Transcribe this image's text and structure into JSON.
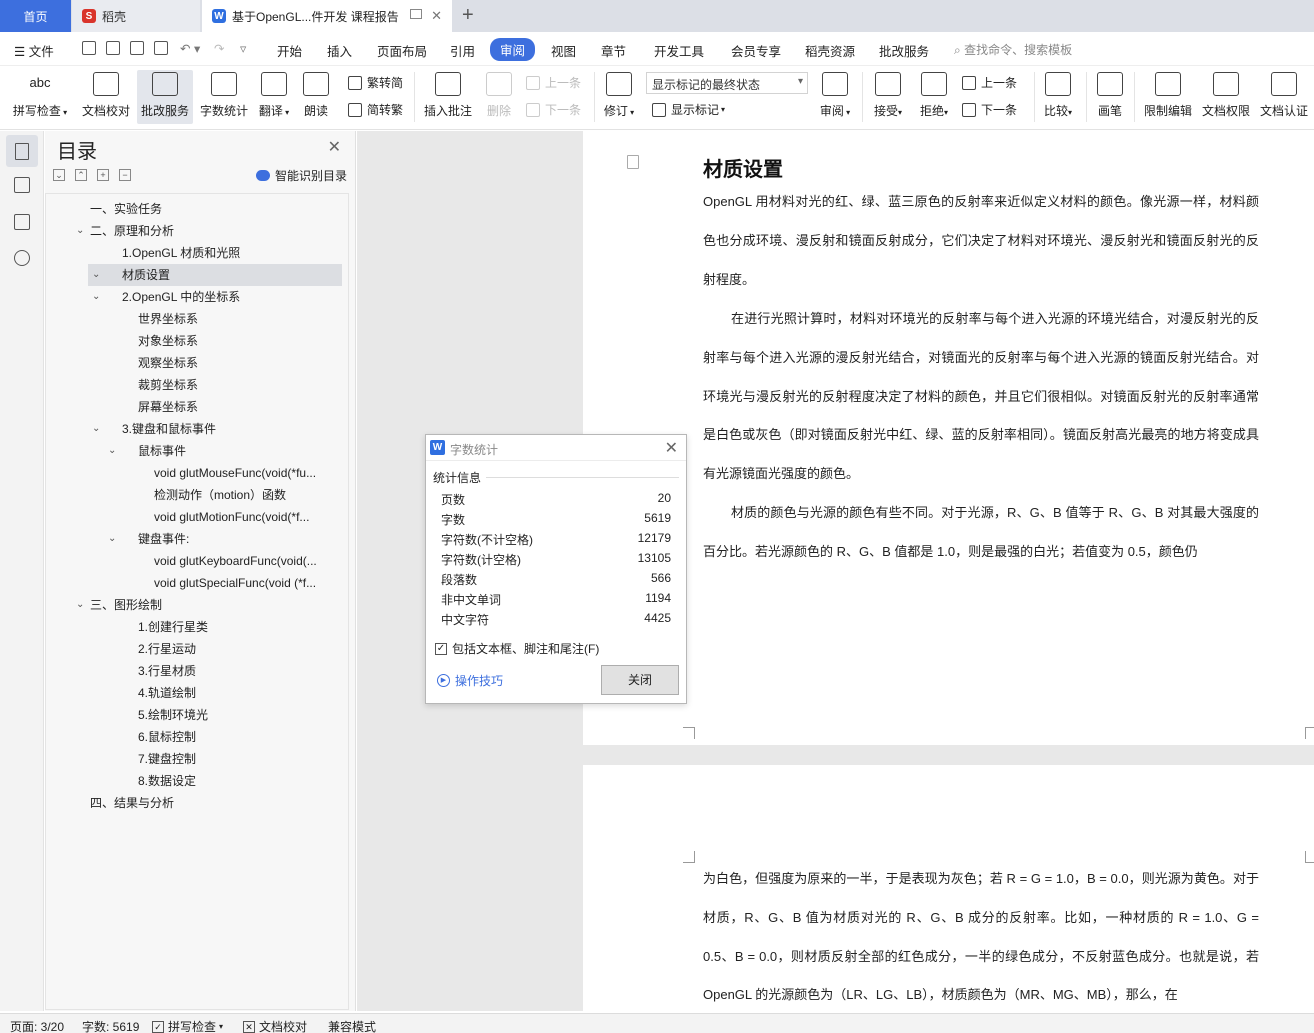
{
  "tabs": {
    "home": "首页",
    "daoke": "稻壳",
    "doc": "基于OpenGL...件开发 课程报告"
  },
  "menu": {
    "file": "文件",
    "items": [
      "开始",
      "插入",
      "页面布局",
      "引用",
      "审阅",
      "视图",
      "章节",
      "开发工具",
      "会员专享",
      "稻壳资源",
      "批改服务"
    ],
    "active": "审阅",
    "search": "查找命令、搜索模板"
  },
  "ribbon": {
    "spellcheck": "拼写检查",
    "doc_proof": "文档校对",
    "review_service": "批改服务",
    "word_count": "字数统计",
    "translate": "翻译",
    "read_aloud": "朗读",
    "trad_to_simp": "繁转简",
    "simp_to_trad": "简转繁",
    "insert_comment": "插入批注",
    "delete": "删除",
    "prev_comment": "上一条",
    "next_comment": "下一条",
    "track_changes": "修订",
    "markup_state": "显示标记的最终状态",
    "show_markup": "显示标记",
    "review": "审阅",
    "accept": "接受",
    "reject": "拒绝",
    "prev_change": "上一条",
    "next_change": "下一条",
    "compare": "比较",
    "pen": "画笔",
    "restrict_edit": "限制编辑",
    "doc_rights": "文档权限",
    "doc_cert": "文档认证"
  },
  "toc": {
    "title": "目录",
    "smart": "智能识别目录",
    "items": [
      {
        "text": "一、实验任务",
        "level": 0,
        "caret": ""
      },
      {
        "text": "二、原理和分析",
        "level": 0,
        "caret": "v"
      },
      {
        "text": "1.OpenGL 材质和光照",
        "level": 1,
        "caret": ""
      },
      {
        "text": "材质设置",
        "level": 1,
        "caret": "v",
        "selected": true
      },
      {
        "text": "2.OpenGL 中的坐标系",
        "level": 1,
        "caret": "v"
      },
      {
        "text": "世界坐标系",
        "level": 2,
        "caret": ""
      },
      {
        "text": "对象坐标系",
        "level": 2,
        "caret": ""
      },
      {
        "text": "观察坐标系",
        "level": 2,
        "caret": ""
      },
      {
        "text": "裁剪坐标系",
        "level": 2,
        "caret": ""
      },
      {
        "text": "屏幕坐标系",
        "level": 2,
        "caret": ""
      },
      {
        "text": "3.键盘和鼠标事件",
        "level": 1,
        "caret": "v"
      },
      {
        "text": "鼠标事件",
        "level": 2,
        "caret": "v"
      },
      {
        "text": "void glutMouseFunc(void(*fu...",
        "level": 3,
        "caret": ""
      },
      {
        "text": "检测动作（motion）函数",
        "level": 3,
        "caret": ""
      },
      {
        "text": "void glutMotionFunc(void(*f...",
        "level": 3,
        "caret": ""
      },
      {
        "text": "键盘事件:",
        "level": 2,
        "caret": "v"
      },
      {
        "text": "void glutKeyboardFunc(void(...",
        "level": 3,
        "caret": ""
      },
      {
        "text": "void glutSpecialFunc(void (*f...",
        "level": 3,
        "caret": ""
      },
      {
        "text": "三、图形绘制",
        "level": 0,
        "caret": "v"
      },
      {
        "text": "1.创建行星类",
        "level": 2,
        "caret": ""
      },
      {
        "text": "2.行星运动",
        "level": 2,
        "caret": ""
      },
      {
        "text": "3.行星材质",
        "level": 2,
        "caret": ""
      },
      {
        "text": "4.轨道绘制",
        "level": 2,
        "caret": ""
      },
      {
        "text": "5.绘制环境光",
        "level": 2,
        "caret": ""
      },
      {
        "text": "6.鼠标控制",
        "level": 2,
        "caret": ""
      },
      {
        "text": "7.键盘控制",
        "level": 2,
        "caret": ""
      },
      {
        "text": "8.数据设定",
        "level": 2,
        "caret": ""
      },
      {
        "text": "四、结果与分析",
        "level": 0,
        "caret": ""
      }
    ]
  },
  "document": {
    "heading": "材质设置",
    "p1": "OpenGL 用材料对光的红、绿、蓝三原色的反射率来近似定义材料的颜色。像光源一样，材料颜色也分成环境、漫反射和镜面反射成分，它们决定了材料对环境光、漫反射光和镜面反射光的反射程度。",
    "p2": "在进行光照计算时，材料对环境光的反射率与每个进入光源的环境光结合，对漫反射光的反射率与每个进入光源的漫反射光结合，对镜面光的反射率与每个进入光源的镜面反射光结合。对环境光与漫反射光的反射程度决定了材料的颜色，并且它们很相似。对镜面反射光的反射率通常是白色或灰色（即对镜面反射光中红、绿、蓝的反射率相同）。镜面反射高光最亮的地方将变成具有光源镜面光强度的颜色。",
    "p3": "材质的颜色与光源的颜色有些不同。对于光源，R、G、B 值等于 R、G、B 对其最大强度的百分比。若光源颜色的 R、G、B 值都是 1.0，则是最强的白光；若值变为 0.5，颜色仍",
    "p4": "为白色，但强度为原来的一半，于是表现为灰色；若 R = G = 1.0，B = 0.0，则光源为黄色。对于材质，R、G、B 值为材质对光的 R、G、B 成分的反射率。比如，一种材质的 R = 1.0、G = 0.5、B = 0.0，则材质反射全部的红色成分，一半的绿色成分，不反射蓝色成分。也就是说，若 OpenGL 的光源颜色为（LR、LG、LB），材质颜色为（MR、MG、MB），那么，在"
  },
  "dialog": {
    "title": "字数统计",
    "section": "统计信息",
    "rows": [
      {
        "label": "页数",
        "value": "20"
      },
      {
        "label": "字数",
        "value": "5619"
      },
      {
        "label": "字符数(不计空格)",
        "value": "12179"
      },
      {
        "label": "字符数(计空格)",
        "value": "13105"
      },
      {
        "label": "段落数",
        "value": "566"
      },
      {
        "label": "非中文单词",
        "value": "1194"
      },
      {
        "label": "中文字符",
        "value": "4425"
      }
    ],
    "checkbox": "包括文本框、脚注和尾注(F)",
    "tips": "操作技巧",
    "close": "关闭"
  },
  "status": {
    "page": "页面: 3/20",
    "words": "字数: 5619",
    "spellcheck": "拼写检查",
    "proof": "文档校对",
    "compat": "兼容模式"
  },
  "colors": {
    "accent": "#3d6fde",
    "canvas": "#e8e8e8"
  }
}
